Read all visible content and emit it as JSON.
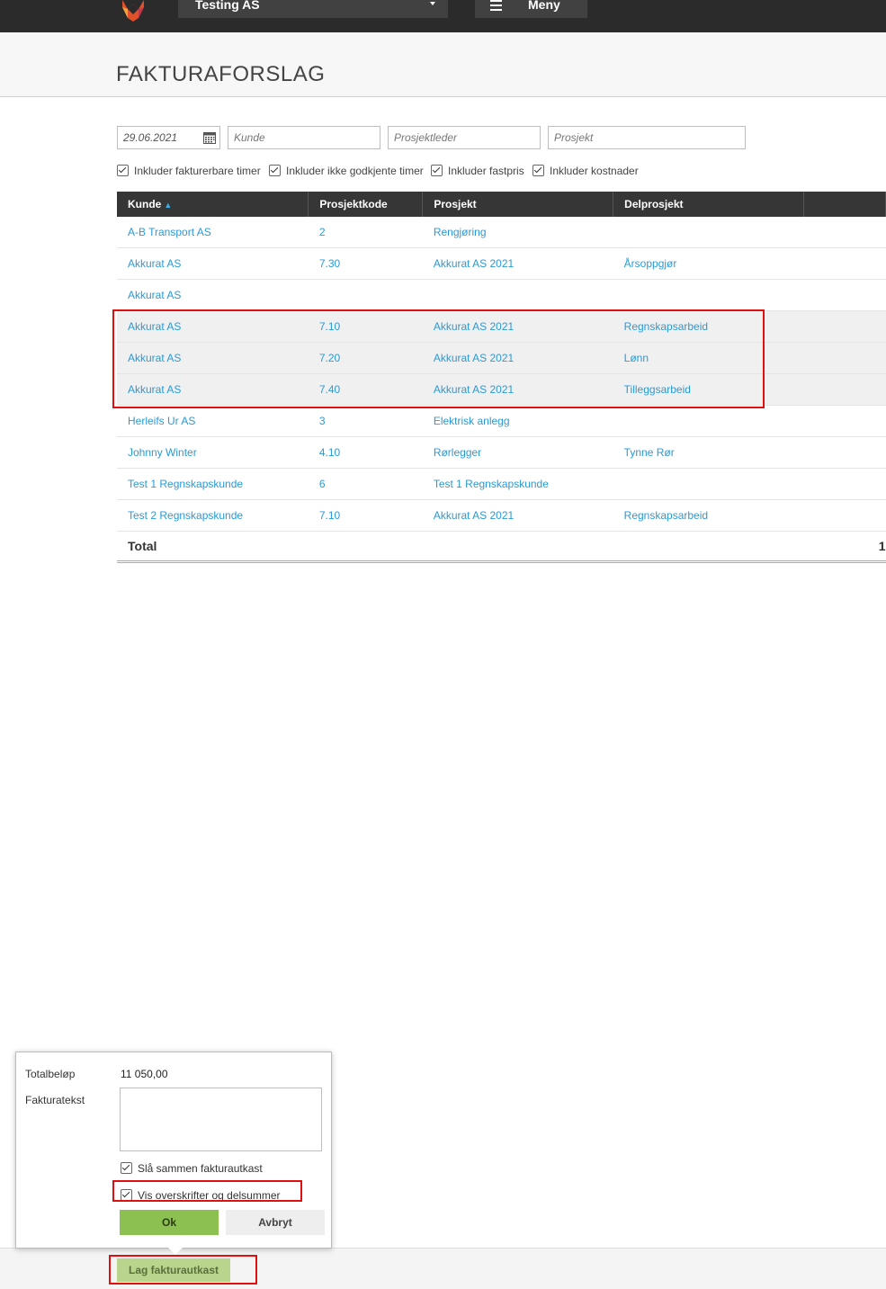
{
  "topbar": {
    "company": "Testing AS",
    "menu_label": "Meny"
  },
  "page_title": "FAKTURAFORSLAG",
  "filters": {
    "date_value": "29.06.2021",
    "customer_placeholder": "Kunde",
    "project_manager_placeholder": "Prosjektleder",
    "project_placeholder": "Prosjekt"
  },
  "checkboxes": [
    {
      "label": "Inkluder fakturerbare timer",
      "checked": true
    },
    {
      "label": "Inkluder ikke godkjente timer",
      "checked": true
    },
    {
      "label": "Inkluder fastpris",
      "checked": true
    },
    {
      "label": "Inkluder kostnader",
      "checked": true
    }
  ],
  "table": {
    "headers": [
      "Kunde",
      "Prosjektkode",
      "Prosjekt",
      "Delprosjekt",
      ""
    ],
    "sort_indicator": "▲",
    "rows": [
      {
        "kunde": "A-B Transport AS",
        "kode": "2",
        "prosjekt": "Rengjøring",
        "delprosjekt": ""
      },
      {
        "kunde": "Akkurat AS",
        "kode": "7.30",
        "prosjekt": "Akkurat AS 2021",
        "delprosjekt": "Årsoppgjør"
      },
      {
        "kunde": "Akkurat AS",
        "kode": "",
        "prosjekt": "",
        "delprosjekt": ""
      },
      {
        "kunde": "Akkurat AS",
        "kode": "7.10",
        "prosjekt": "Akkurat AS 2021",
        "delprosjekt": "Regnskapsarbeid"
      },
      {
        "kunde": "Akkurat AS",
        "kode": "7.20",
        "prosjekt": "Akkurat AS 2021",
        "delprosjekt": "Lønn"
      },
      {
        "kunde": "Akkurat AS",
        "kode": "7.40",
        "prosjekt": "Akkurat AS 2021",
        "delprosjekt": "Tilleggsarbeid"
      },
      {
        "kunde": "Herleifs Ur AS",
        "kode": "3",
        "prosjekt": "Elektrisk anlegg",
        "delprosjekt": ""
      },
      {
        "kunde": "Johnny Winter",
        "kode": "4.10",
        "prosjekt": "Rørlegger",
        "delprosjekt": "Tynne Rør"
      },
      {
        "kunde": "Test 1 Regnskapskunde",
        "kode": "6",
        "prosjekt": "Test 1 Regnskapskunde",
        "delprosjekt": ""
      },
      {
        "kunde": "Test 2 Regnskapskunde",
        "kode": "7.10",
        "prosjekt": "Akkurat AS 2021",
        "delprosjekt": "Regnskapsarbeid"
      }
    ],
    "total_label": "Total",
    "total_value": "1"
  },
  "popup": {
    "total_label": "Totalbeløp",
    "total_value": "11 050,00",
    "text_label": "Fakturatekst",
    "merge_label": "Slå sammen fakturautkast",
    "merge_checked": true,
    "headings_label": "Vis overskrifter og delsummer",
    "headings_checked": true,
    "ok_label": "Ok",
    "cancel_label": "Avbryt"
  },
  "footer": {
    "draft_button": "Lag fakturautkast"
  },
  "colors": {
    "link": "#2a9ad6",
    "header_bg": "#363636",
    "ok_green": "#8cc152",
    "highlight_red": "#e01010"
  }
}
